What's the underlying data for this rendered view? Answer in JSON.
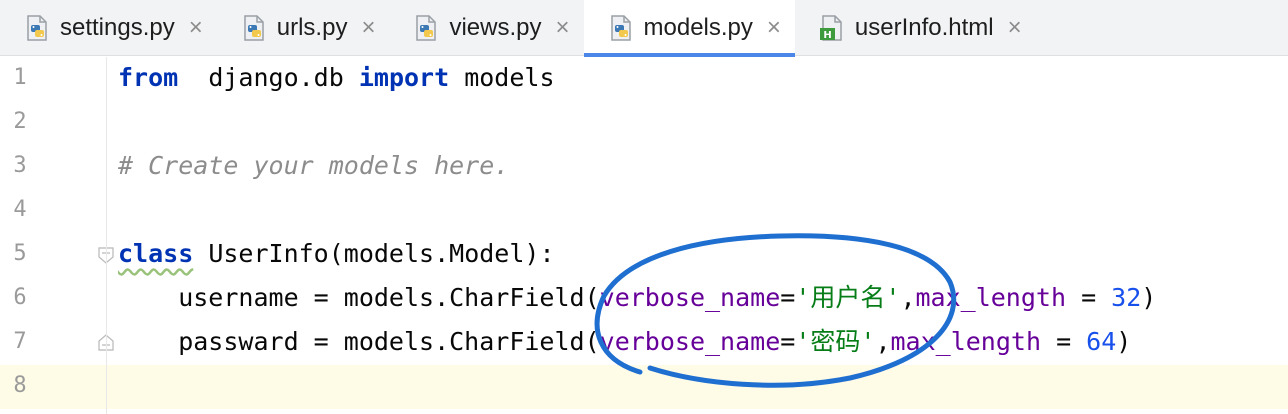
{
  "tabs": [
    {
      "label": "settings.py",
      "icon": "python-file-icon",
      "active": false
    },
    {
      "label": "urls.py",
      "icon": "python-file-icon",
      "active": false
    },
    {
      "label": "views.py",
      "icon": "python-file-icon",
      "active": false
    },
    {
      "label": "models.py",
      "icon": "python-file-icon",
      "active": true
    },
    {
      "label": "userInfo.html",
      "icon": "html-file-icon",
      "active": false
    }
  ],
  "close_glyph": "×",
  "editor": {
    "current_line": 8,
    "lines": [
      {
        "num": "1",
        "tokens": [
          [
            "kw",
            "from"
          ],
          [
            "",
            "  django.db "
          ],
          [
            "kw",
            "import"
          ],
          [
            "",
            " models"
          ]
        ]
      },
      {
        "num": "2",
        "tokens": []
      },
      {
        "num": "3",
        "tokens": [
          [
            "cm",
            "# Create your models here."
          ]
        ]
      },
      {
        "num": "4",
        "tokens": []
      },
      {
        "num": "5",
        "tokens": [
          [
            "kw",
            "class"
          ],
          [
            "",
            " UserInfo(models.Model):"
          ]
        ]
      },
      {
        "num": "6",
        "tokens": [
          [
            "",
            "    username = models.CharField("
          ],
          [
            "arg",
            "verbose_name"
          ],
          [
            "",
            "="
          ],
          [
            "str",
            "'用户名'"
          ],
          [
            ",",
            ","
          ],
          [
            "arg",
            "max_length"
          ],
          [
            "",
            " = "
          ],
          [
            "num",
            "32"
          ],
          [
            "",
            ")"
          ]
        ]
      },
      {
        "num": "7",
        "tokens": [
          [
            "",
            "    passward = models.CharField("
          ],
          [
            "arg",
            "verbose_name"
          ],
          [
            "",
            "="
          ],
          [
            "str",
            "'密码'"
          ],
          [
            ",",
            ","
          ],
          [
            "arg",
            "max_length"
          ],
          [
            "",
            " = "
          ],
          [
            "num",
            "64"
          ],
          [
            "",
            ")"
          ]
        ]
      },
      {
        "num": "8",
        "tokens": []
      }
    ]
  },
  "colors": {
    "keyword": "#0033b3",
    "comment": "#8c8c8c",
    "named_arg": "#660099",
    "string": "#067d17",
    "number": "#1750eb",
    "annotation_circle": "#1f6fd1"
  }
}
